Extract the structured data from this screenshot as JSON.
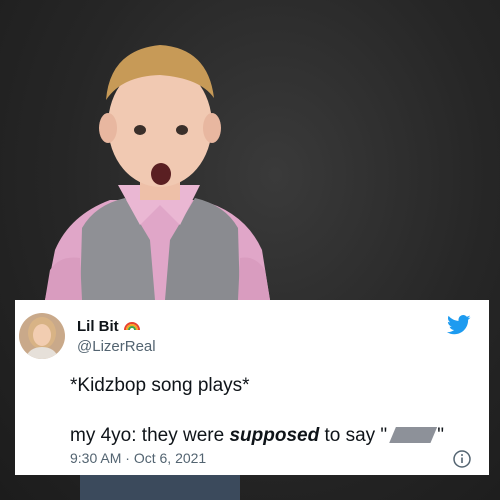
{
  "tweet": {
    "display_name": "Lil Bit",
    "handle": "@LizerReal",
    "line1": "*Kidzbop song plays*",
    "line2_prefix": "my 4yo: they were ",
    "line2_emphasis": "supposed",
    "line2_suffix": " to say \"",
    "line2_close": "\"",
    "time": "9:30 AM",
    "separator": "·",
    "date": "Oct 6, 2021"
  },
  "icons": {
    "name_badge": "rainbow-icon",
    "logo": "twitter-bird-icon",
    "info": "info-icon"
  },
  "colors": {
    "twitter_blue": "#1d9bf0",
    "text_primary": "#0f1419",
    "text_secondary": "#536471",
    "background": "#262626"
  }
}
